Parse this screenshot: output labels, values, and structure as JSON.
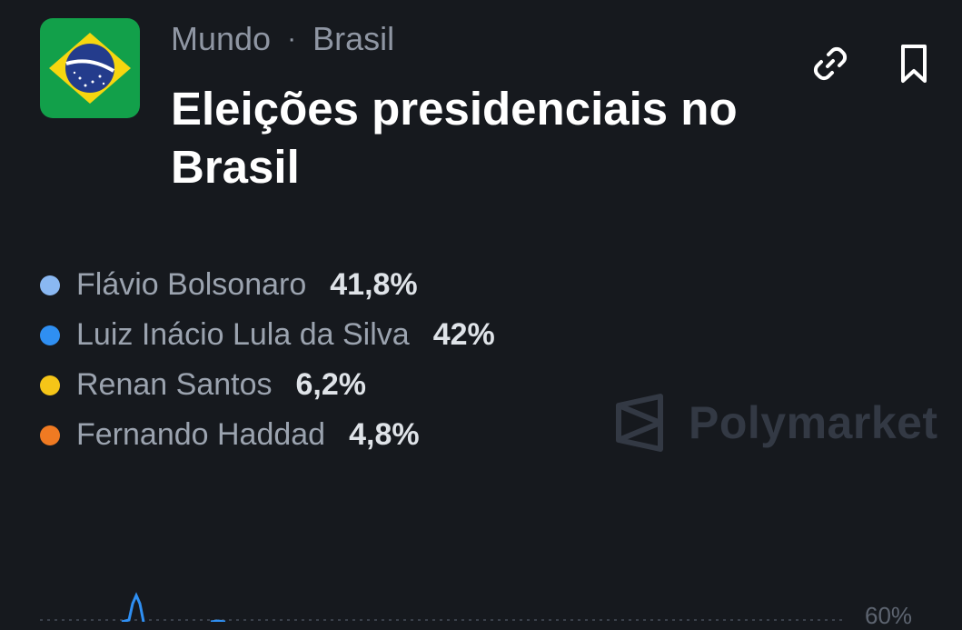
{
  "header": {
    "breadcrumb": [
      "Mundo",
      "Brasil"
    ],
    "title": "Eleições presidenciais no Brasil"
  },
  "icons": {
    "flag": "brazil-flag-icon",
    "link": "link-icon",
    "bookmark": "bookmark-icon"
  },
  "candidates": [
    {
      "name": "Flávio Bolsonaro",
      "percent": "41,8%",
      "color": "#8ab8f2"
    },
    {
      "name": "Luiz Inácio Lula da Silva",
      "percent": "42%",
      "color": "#2f8ff2"
    },
    {
      "name": "Renan Santos",
      "percent": "6,2%",
      "color": "#f5c518"
    },
    {
      "name": "Fernando Haddad",
      "percent": "4,8%",
      "color": "#f07a22"
    }
  ],
  "watermark": "Polymarket",
  "chart": {
    "y_tick_label": "60%",
    "line_color": "#2f8ff2"
  }
}
